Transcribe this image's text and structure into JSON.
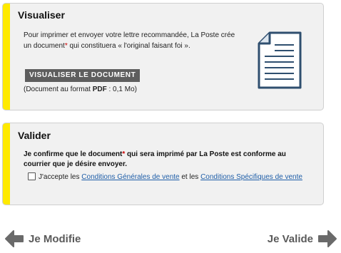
{
  "visualiser": {
    "title": "Visualiser",
    "text_1": "Pour imprimer et envoyer votre lettre recommandée, La Poste crée un document",
    "text_star": "*",
    "text_2": " qui constituera « l'original faisant foi ».",
    "button_label": "VISUALISER LE DOCUMENT",
    "format_prefix": "(Document au format ",
    "format_bold": "PDF",
    "format_suffix": " : 0,1 Mo)",
    "icon": "document-icon"
  },
  "valider": {
    "title": "Valider",
    "confirm_1": "Je confirme que le document",
    "confirm_star": "*",
    "confirm_2": " qui sera imprimé par La Poste est conforme au courrier que je désire envoyer.",
    "accept_prefix": "J'accepte les ",
    "cgv_link": "Conditions Générales de vente",
    "accept_middle": " et les ",
    "csv_link": "Conditions Spécifiques de vente"
  },
  "nav": {
    "prev_label": "Je Modifie",
    "next_label": "Je Valide"
  },
  "colors": {
    "stripe": "#ffea00",
    "button": "#5e5e5e",
    "link": "#1f5ea8",
    "required_star": "#cc0000"
  }
}
